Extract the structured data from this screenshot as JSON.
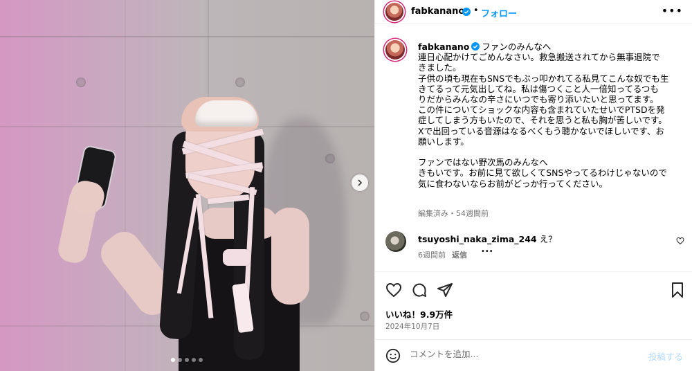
{
  "header": {
    "username": "fabkanano",
    "separator": "•",
    "follow_label": "フォロー",
    "more_label": "•••"
  },
  "caption": {
    "username": "fabkanano",
    "lines": [
      "ファンのみんなへ",
      "連日心配かけてごめんなさい。救急搬送されてから無事退院で",
      "きました。",
      "子供の頃も現在もSNSでもぶっ叩かれてる私見てこんな奴でも生",
      "きてるって元気出してね。私は傷つくこと人一倍知ってるつも",
      "りだからみんなの辛さにいつでも寄り添いたいと思ってます。",
      "この件についてショックな内容も含まれていたせいでPTSDを発",
      "症してしまう方もいたので、それを思うと私も胸が苦しいです。",
      "Xで出回っている音源はなるべくもう聴かないでほしいです、お",
      "願いします。",
      "",
      "ファンではない野次馬のみんなへ",
      "きもいです。お前に見て欲しくてSNSやってるわけじゃないので",
      "気に食わないならお前がどっか行ってください。"
    ],
    "meta": "編集済み・54週間前"
  },
  "comment": {
    "username": "tsuyoshi_naka_zima_244",
    "text": "え？",
    "age": "6週間前",
    "reply_label": "返信",
    "more_label": "•••"
  },
  "post": {
    "likes": "いいね！9.9万件",
    "date": "2024年10月7日"
  },
  "add_comment": {
    "placeholder": "コメントを追加...",
    "post_label": "投稿する"
  },
  "carousel": {
    "slide_count": 5,
    "active_index": 0
  },
  "colors": {
    "accent": "#0095f6",
    "muted": "#737373",
    "verified": "#0095f6"
  },
  "icons": [
    "verified-badge-icon",
    "more-options-icon",
    "chevron-right-icon",
    "heart-icon",
    "comment-icon",
    "share-icon",
    "bookmark-icon",
    "emoji-icon"
  ]
}
